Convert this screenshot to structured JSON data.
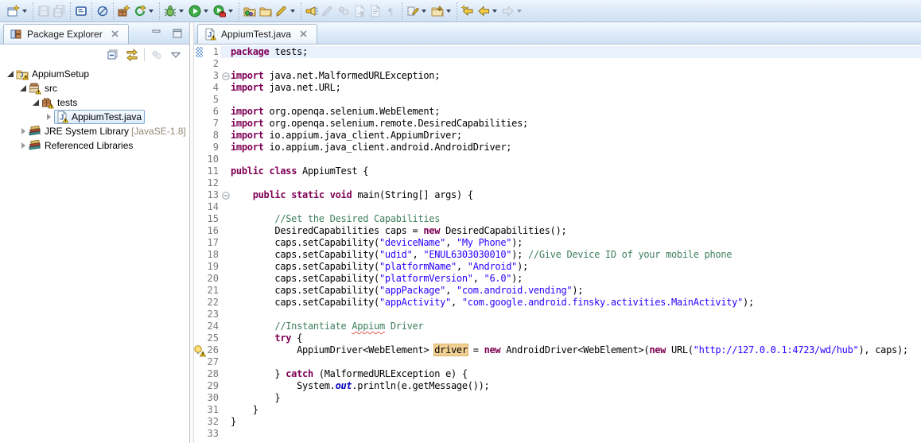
{
  "toolbar": {
    "groups": [
      {
        "items": [
          {
            "name": "new",
            "icon": "new-wizard",
            "enabled": true,
            "dropdown": true
          }
        ]
      },
      {
        "items": [
          {
            "name": "save",
            "icon": "save",
            "enabled": false
          },
          {
            "name": "save-all",
            "icon": "save-all",
            "enabled": false
          }
        ]
      },
      {
        "items": [
          {
            "name": "open-console",
            "icon": "console",
            "enabled": true
          }
        ]
      },
      {
        "items": [
          {
            "name": "skip-all-breakpoints",
            "icon": "skip-breakpoints",
            "enabled": true
          }
        ]
      },
      {
        "items": [
          {
            "name": "new-java-package",
            "icon": "new-package",
            "enabled": true
          },
          {
            "name": "coverage",
            "icon": "coverage",
            "enabled": true,
            "dropdown": true
          }
        ]
      },
      {
        "items": [
          {
            "name": "debug",
            "icon": "debug",
            "enabled": true,
            "dropdown": true
          },
          {
            "name": "run",
            "icon": "run",
            "enabled": true,
            "dropdown": true
          },
          {
            "name": "run-external-tools",
            "icon": "external-tools",
            "enabled": true,
            "dropdown": true
          }
        ]
      },
      {
        "items": [
          {
            "name": "import-resource",
            "icon": "import-folder",
            "enabled": true
          },
          {
            "name": "open-resource",
            "icon": "open-folder",
            "enabled": true
          },
          {
            "name": "annotate",
            "icon": "pen",
            "enabled": true,
            "dropdown": true
          }
        ]
      },
      {
        "items": [
          {
            "name": "search",
            "icon": "flashlight",
            "enabled": true
          },
          {
            "name": "mark-occurrences",
            "icon": "brush",
            "enabled": false
          },
          {
            "name": "collaboration",
            "icon": "people",
            "enabled": false
          },
          {
            "name": "next-match",
            "icon": "doc-forward",
            "enabled": false
          },
          {
            "name": "show-source",
            "icon": "doc-list",
            "enabled": false
          },
          {
            "name": "show-whitespace",
            "icon": "pilcrow",
            "enabled": false
          }
        ]
      },
      {
        "items": [
          {
            "name": "next-annotation",
            "icon": "edit-pencil",
            "enabled": true,
            "dropdown": true
          },
          {
            "name": "previous-annotation",
            "icon": "folder-up",
            "enabled": true,
            "dropdown": true
          }
        ]
      },
      {
        "items": [
          {
            "name": "last-edit-location",
            "icon": "last-edit",
            "enabled": true
          },
          {
            "name": "back",
            "icon": "back-arrow",
            "enabled": true,
            "dropdown": true
          },
          {
            "name": "forward",
            "icon": "forward-arrow",
            "enabled": false,
            "dropdown": true
          }
        ]
      }
    ]
  },
  "package_explorer": {
    "title": "Package Explorer",
    "tab_icon": "package-explorer-icon",
    "close_label": "close",
    "view_toolbar": [
      {
        "name": "collapse-all",
        "icon": "collapse-all",
        "enabled": true
      },
      {
        "name": "link-with-editor",
        "icon": "link-editor",
        "enabled": true
      },
      {
        "name": "separator"
      },
      {
        "name": "focus-on-active-task",
        "icon": "focus",
        "enabled": false
      },
      {
        "name": "view-menu",
        "icon": "view-menu",
        "enabled": true
      }
    ],
    "window_buttons": [
      {
        "name": "minimize",
        "icon": "minimize"
      },
      {
        "name": "maximize",
        "icon": "maximize"
      }
    ],
    "tree": [
      {
        "depth": 0,
        "expander": "expanded",
        "icon": "java-project-warning",
        "label": "AppiumSetup",
        "selected": false
      },
      {
        "depth": 1,
        "expander": "expanded",
        "icon": "source-folder-warning",
        "label": "src",
        "selected": false
      },
      {
        "depth": 2,
        "expander": "expanded",
        "icon": "package-warning",
        "label": "tests",
        "selected": false
      },
      {
        "depth": 3,
        "expander": "collapsed",
        "icon": "java-file-warning",
        "label": "AppiumTest.java",
        "selected": true
      },
      {
        "depth": 1,
        "expander": "collapsed",
        "icon": "library",
        "label": "JRE System Library",
        "decoration": " [JavaSE-1.8]",
        "selected": false
      },
      {
        "depth": 1,
        "expander": "collapsed",
        "icon": "library",
        "label": "Referenced Libraries",
        "selected": false
      }
    ]
  },
  "editor": {
    "tab": {
      "label": "AppiumTest.java",
      "icon": "java-file-warning",
      "close_label": "close"
    },
    "current_line": 1,
    "fold_lines": [
      3,
      13
    ],
    "gutter_icons": [
      {
        "line": 1,
        "icon": "range-indicator"
      },
      {
        "line": 26,
        "icon": "quickfix-warning"
      }
    ],
    "colors": {
      "keyword": "#7f0055",
      "string": "#2a00ff",
      "comment": "#3f7f5f",
      "static_field": "#0000c0",
      "current_line_bg": "#e9f2fc",
      "occurrence_bg": "#f1d093"
    },
    "lines": [
      {
        "segs": [
          {
            "c": "k",
            "t": "package"
          },
          {
            "c": "d",
            "t": " tests;"
          }
        ]
      },
      {
        "segs": []
      },
      {
        "segs": [
          {
            "c": "k",
            "t": "import"
          },
          {
            "c": "d",
            "t": " java.net.MalformedURLException;"
          }
        ]
      },
      {
        "segs": [
          {
            "c": "k",
            "t": "import"
          },
          {
            "c": "d",
            "t": " java.net.URL;"
          }
        ]
      },
      {
        "segs": []
      },
      {
        "segs": [
          {
            "c": "k",
            "t": "import"
          },
          {
            "c": "d",
            "t": " org.openqa.selenium.WebElement;"
          }
        ]
      },
      {
        "segs": [
          {
            "c": "k",
            "t": "import"
          },
          {
            "c": "d",
            "t": " org.openqa.selenium.remote.DesiredCapabilities;"
          }
        ]
      },
      {
        "segs": [
          {
            "c": "k",
            "t": "import"
          },
          {
            "c": "d",
            "t": " io.appium.java_client.AppiumDriver;"
          }
        ]
      },
      {
        "segs": [
          {
            "c": "k",
            "t": "import"
          },
          {
            "c": "d",
            "t": " io.appium.java_client.android.AndroidDriver;"
          }
        ]
      },
      {
        "segs": []
      },
      {
        "segs": [
          {
            "c": "k",
            "t": "public"
          },
          {
            "c": "d",
            "t": " "
          },
          {
            "c": "k",
            "t": "class"
          },
          {
            "c": "d",
            "t": " AppiumTest {"
          }
        ]
      },
      {
        "segs": []
      },
      {
        "segs": [
          {
            "c": "d",
            "t": "    "
          },
          {
            "c": "k",
            "t": "public"
          },
          {
            "c": "d",
            "t": " "
          },
          {
            "c": "k",
            "t": "static"
          },
          {
            "c": "d",
            "t": " "
          },
          {
            "c": "k",
            "t": "void"
          },
          {
            "c": "d",
            "t": " main(String[] args) {"
          }
        ]
      },
      {
        "segs": []
      },
      {
        "segs": [
          {
            "c": "d",
            "t": "        "
          },
          {
            "c": "c",
            "t": "//Set the Desired Capabilities"
          }
        ]
      },
      {
        "segs": [
          {
            "c": "d",
            "t": "        DesiredCapabilities caps = "
          },
          {
            "c": "k",
            "t": "new"
          },
          {
            "c": "d",
            "t": " DesiredCapabilities();"
          }
        ]
      },
      {
        "segs": [
          {
            "c": "d",
            "t": "        caps.setCapability("
          },
          {
            "c": "s",
            "t": "\"deviceName\""
          },
          {
            "c": "d",
            "t": ", "
          },
          {
            "c": "s",
            "t": "\"My Phone\""
          },
          {
            "c": "d",
            "t": ");"
          }
        ]
      },
      {
        "segs": [
          {
            "c": "d",
            "t": "        caps.setCapability("
          },
          {
            "c": "s",
            "t": "\"udid\""
          },
          {
            "c": "d",
            "t": ", "
          },
          {
            "c": "s",
            "t": "\"ENUL6303030010\""
          },
          {
            "c": "d",
            "t": "); "
          },
          {
            "c": "c",
            "t": "//Give Device ID of your mobile phone"
          }
        ]
      },
      {
        "segs": [
          {
            "c": "d",
            "t": "        caps.setCapability("
          },
          {
            "c": "s",
            "t": "\"platformName\""
          },
          {
            "c": "d",
            "t": ", "
          },
          {
            "c": "s",
            "t": "\"Android\""
          },
          {
            "c": "d",
            "t": ");"
          }
        ]
      },
      {
        "segs": [
          {
            "c": "d",
            "t": "        caps.setCapability("
          },
          {
            "c": "s",
            "t": "\"platformVersion\""
          },
          {
            "c": "d",
            "t": ", "
          },
          {
            "c": "s",
            "t": "\"6.0\""
          },
          {
            "c": "d",
            "t": ");"
          }
        ]
      },
      {
        "segs": [
          {
            "c": "d",
            "t": "        caps.setCapability("
          },
          {
            "c": "s",
            "t": "\"appPackage\""
          },
          {
            "c": "d",
            "t": ", "
          },
          {
            "c": "s",
            "t": "\"com.android.vending\""
          },
          {
            "c": "d",
            "t": ");"
          }
        ]
      },
      {
        "segs": [
          {
            "c": "d",
            "t": "        caps.setCapability("
          },
          {
            "c": "s",
            "t": "\"appActivity\""
          },
          {
            "c": "d",
            "t": ", "
          },
          {
            "c": "s",
            "t": "\"com.google.android.finsky.activities.MainActivity\""
          },
          {
            "c": "d",
            "t": ");"
          }
        ]
      },
      {
        "segs": []
      },
      {
        "segs": [
          {
            "c": "d",
            "t": "        "
          },
          {
            "c": "c",
            "t": "//Instantiate "
          },
          {
            "c": "cw",
            "t": "Appium"
          },
          {
            "c": "c",
            "t": " Driver"
          }
        ]
      },
      {
        "segs": [
          {
            "c": "d",
            "t": "        "
          },
          {
            "c": "k",
            "t": "try"
          },
          {
            "c": "d",
            "t": " {"
          }
        ]
      },
      {
        "segs": [
          {
            "c": "d",
            "t": "            AppiumDriver<WebElement> "
          },
          {
            "c": "hl",
            "t": "driver"
          },
          {
            "c": "d",
            "t": " = "
          },
          {
            "c": "k",
            "t": "new"
          },
          {
            "c": "d",
            "t": " AndroidDriver<WebElement>("
          },
          {
            "c": "k",
            "t": "new"
          },
          {
            "c": "d",
            "t": " URL("
          },
          {
            "c": "s",
            "t": "\"http://127.0.0.1:4723/wd/hub\""
          },
          {
            "c": "d",
            "t": "), caps);"
          }
        ]
      },
      {
        "segs": []
      },
      {
        "segs": [
          {
            "c": "d",
            "t": "        } "
          },
          {
            "c": "k",
            "t": "catch"
          },
          {
            "c": "d",
            "t": " (MalformedURLException e) {"
          }
        ]
      },
      {
        "segs": [
          {
            "c": "d",
            "t": "            System."
          },
          {
            "c": "f",
            "t": "out"
          },
          {
            "c": "d",
            "t": ".println(e.getMessage());"
          }
        ]
      },
      {
        "segs": [
          {
            "c": "d",
            "t": "        }"
          }
        ]
      },
      {
        "segs": [
          {
            "c": "d",
            "t": "    }"
          }
        ]
      },
      {
        "segs": [
          {
            "c": "d",
            "t": "}"
          }
        ]
      },
      {
        "segs": []
      }
    ]
  }
}
